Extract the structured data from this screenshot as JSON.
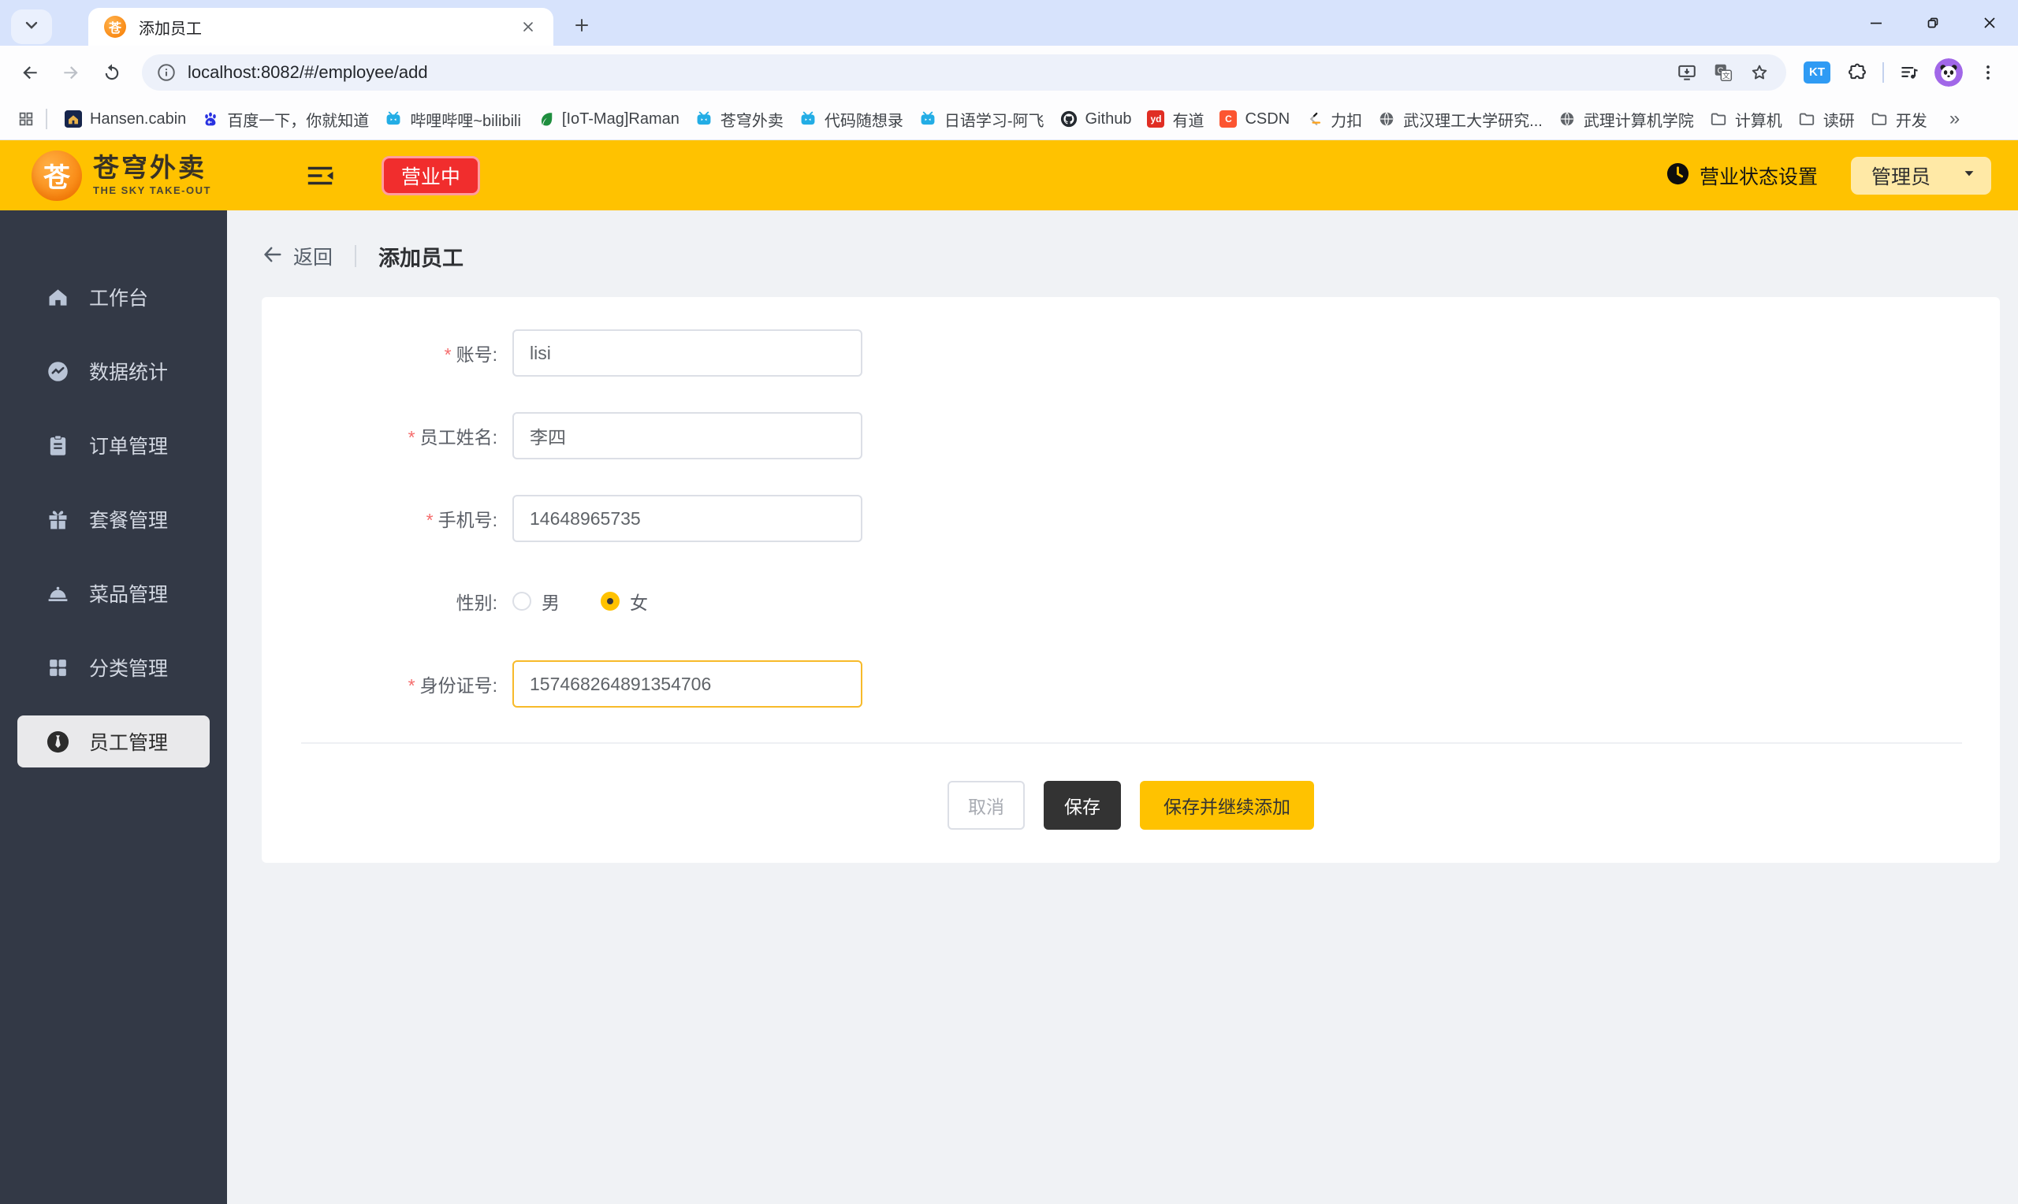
{
  "browser": {
    "tab_title": "添加员工",
    "url": "localhost:8082/#/employee/add",
    "extension_badge": "KT",
    "bookmarks_overflow": "»",
    "bookmarks": [
      {
        "label": "Hansen.cabin",
        "icon": "home-favicon"
      },
      {
        "label": "百度一下，你就知道",
        "icon": "baidu-favicon"
      },
      {
        "label": "哔哩哔哩~bilibili",
        "icon": "bilibili-favicon"
      },
      {
        "label": "[IoT-Mag]Raman",
        "icon": "leaf-favicon"
      },
      {
        "label": "苍穹外卖",
        "icon": "bilibili-favicon"
      },
      {
        "label": "代码随想录",
        "icon": "bilibili-favicon"
      },
      {
        "label": "日语学习-阿飞",
        "icon": "bilibili-favicon"
      },
      {
        "label": "Github",
        "icon": "github-favicon"
      },
      {
        "label": "有道",
        "icon": "badge",
        "badge_text": "yd",
        "badge_color": "#e02e24"
      },
      {
        "label": "CSDN",
        "icon": "badge",
        "badge_text": "C",
        "badge_color": "#fc5531"
      },
      {
        "label": "力扣",
        "icon": "leetcode-favicon"
      },
      {
        "label": "武汉理工大学研究...",
        "icon": "globe-favicon"
      },
      {
        "label": "武理计算机学院",
        "icon": "globe-favicon"
      },
      {
        "label": "计算机",
        "icon": "folder-favicon"
      },
      {
        "label": "读研",
        "icon": "folder-favicon"
      },
      {
        "label": "开发",
        "icon": "folder-favicon"
      }
    ]
  },
  "header": {
    "logo_glyph": "苍",
    "brand_name": "苍穹外卖",
    "brand_tagline": "THE SKY TAKE-OUT",
    "status_badge": "营业中",
    "status_setting_label": "营业状态设置",
    "user_menu_label": "管理员"
  },
  "sidebar": {
    "items": [
      {
        "label": "工作台",
        "icon": "home-icon",
        "active": false
      },
      {
        "label": "数据统计",
        "icon": "stats-icon",
        "active": false
      },
      {
        "label": "订单管理",
        "icon": "order-icon",
        "active": false
      },
      {
        "label": "套餐管理",
        "icon": "combo-icon",
        "active": false
      },
      {
        "label": "菜品管理",
        "icon": "dish-icon",
        "active": false
      },
      {
        "label": "分类管理",
        "icon": "category-icon",
        "active": false
      },
      {
        "label": "员工管理",
        "icon": "employee-icon",
        "active": true
      }
    ]
  },
  "main": {
    "back_label": "返回",
    "page_title": "添加员工",
    "form": {
      "fields": [
        {
          "type": "text",
          "label": "账号:",
          "required": true,
          "value": "lisi"
        },
        {
          "type": "text",
          "label": "员工姓名:",
          "required": true,
          "value": "李四"
        },
        {
          "type": "text",
          "label": "手机号:",
          "required": true,
          "value": "14648965735"
        },
        {
          "type": "radio",
          "label": "性别:",
          "required": false,
          "options": [
            "男",
            "女"
          ],
          "selected": "女"
        },
        {
          "type": "text",
          "label": "身份证号:",
          "required": true,
          "value": "157468264891354706",
          "focused": true
        }
      ],
      "buttons": [
        {
          "label": "取消",
          "style": "plain"
        },
        {
          "label": "保存",
          "style": "dark"
        },
        {
          "label": "保存并继续添加",
          "style": "primary"
        }
      ]
    }
  },
  "colors": {
    "brand_yellow": "#ffc200",
    "badge_red": "#f12d2d",
    "sidebar_dark": "#333946",
    "focus_border": "#f7ba2a",
    "titlebar_blue": "#d7e3fc"
  }
}
